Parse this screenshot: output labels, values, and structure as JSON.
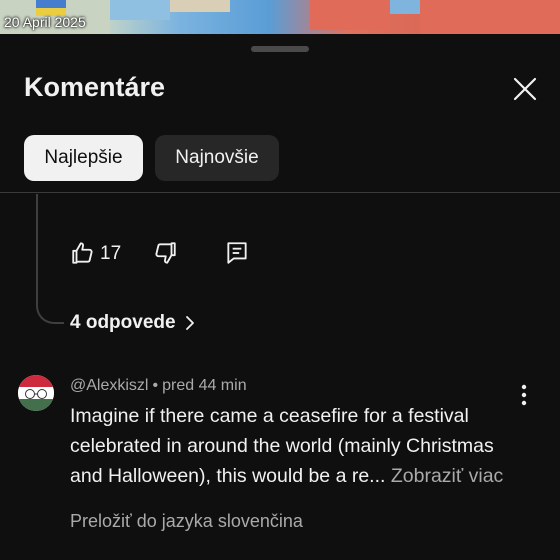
{
  "video": {
    "date_label": "20 April 2025"
  },
  "sheet": {
    "title": "Komentáre",
    "close_icon": "close-icon"
  },
  "sort_chips": [
    {
      "label": "Najlepšie",
      "selected": true
    },
    {
      "label": "Najnovšie",
      "selected": false
    }
  ],
  "previous_comment": {
    "like_count": "17",
    "icons": [
      "thumbs-up-icon",
      "thumbs-down-icon",
      "reply-icon"
    ],
    "replies_label": "4 odpovede"
  },
  "comment": {
    "author": "@Alexkiszl",
    "separator": "•",
    "time": "pred 44 min",
    "text_lines": [
      "Imagine if there came a ceasefire for a festival",
      "celebrated in around the world (mainly Christmas",
      "and Halloween), this would be a re..."
    ],
    "read_more": "Zobraziť viac",
    "translate": "Preložiť do jazyka slovenčina",
    "avatar_icon": "hungarian-flag-avatar"
  },
  "colors": {
    "background": "#0f0f0f",
    "text_primary": "#f1f1f1",
    "text_secondary": "#aaaaaa",
    "chip_active_bg": "#f1f1f1",
    "chip_inactive_bg": "#272727"
  }
}
